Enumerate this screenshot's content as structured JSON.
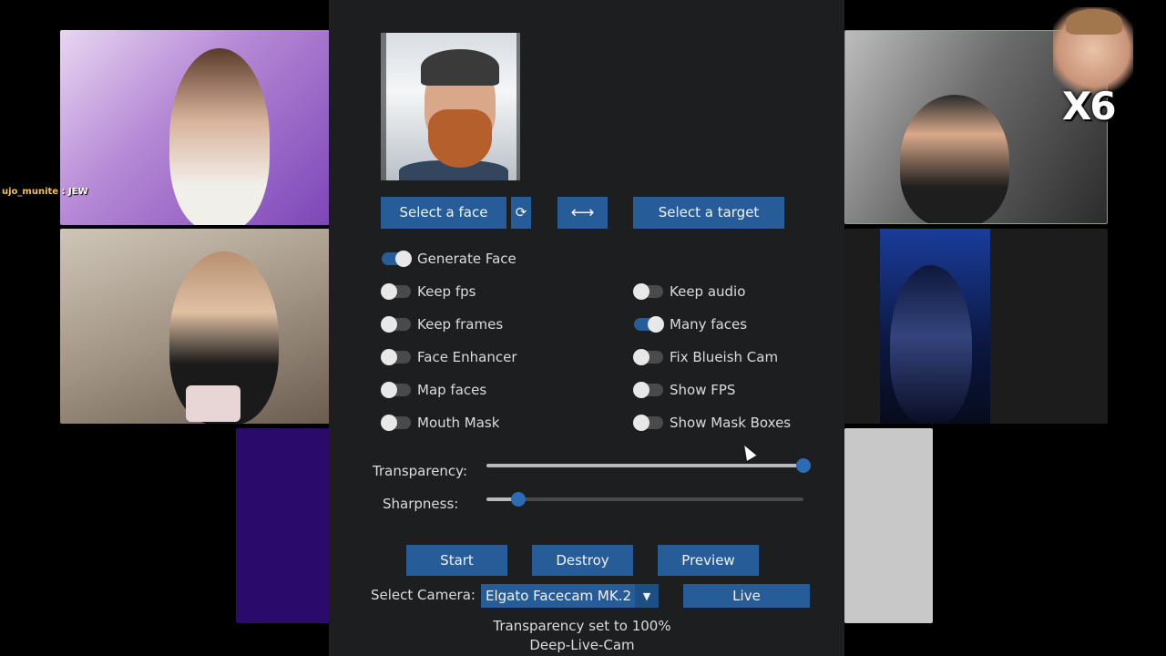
{
  "chat": {
    "username": "ujo_munite",
    "separator": " : ",
    "message": "JEW"
  },
  "overlay": {
    "multiplier": "X6"
  },
  "app": {
    "title": "Deep-Live-Cam",
    "buttons": {
      "select_face": "Select a face",
      "refresh": "⟳",
      "swap": "⟷",
      "select_target": "Select a target",
      "start": "Start",
      "destroy": "Destroy",
      "preview": "Preview",
      "live": "Live"
    },
    "toggles": [
      {
        "label": "Generate Face",
        "on": true
      },
      {
        "label": "Keep fps",
        "on": false
      },
      {
        "label": "Keep audio",
        "on": false
      },
      {
        "label": "Keep frames",
        "on": false
      },
      {
        "label": "Many faces",
        "on": true
      },
      {
        "label": "Face Enhancer",
        "on": false
      },
      {
        "label": "Fix Blueish Cam",
        "on": false
      },
      {
        "label": "Map faces",
        "on": false
      },
      {
        "label": "Show FPS",
        "on": false
      },
      {
        "label": "Mouth Mask",
        "on": false
      },
      {
        "label": "Show Mask Boxes",
        "on": false
      }
    ],
    "sliders": {
      "transparency": {
        "label": "Transparency:",
        "value": 1.0
      },
      "sharpness": {
        "label": "Sharpness:",
        "value": 0.1
      }
    },
    "camera": {
      "label": "Select Camera:",
      "selected": "Elgato Facecam MK.2",
      "dropdown_icon": "chevron-down-icon"
    },
    "status": "Transparency set to 100%"
  },
  "colors": {
    "accent": "#265d98",
    "panel_bg": "#1d1e20",
    "text": "#dcdcdc"
  }
}
